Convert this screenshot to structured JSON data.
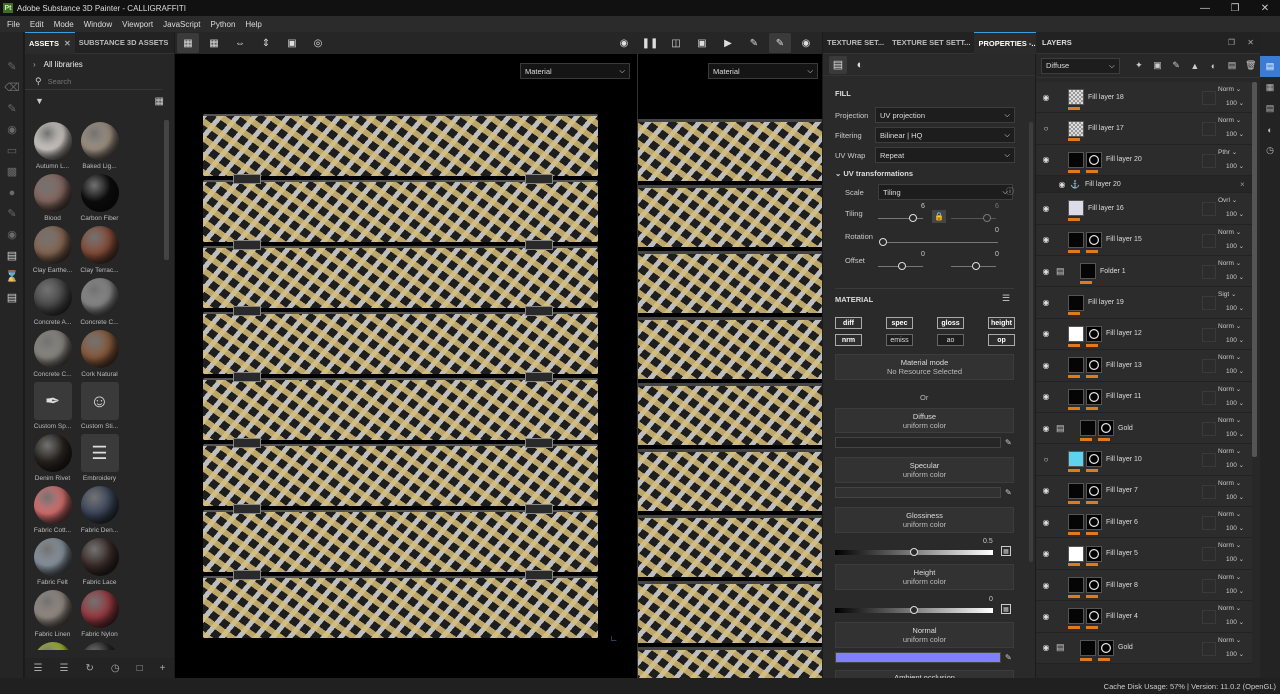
{
  "window": {
    "title": "Adobe Substance 3D Painter - CALLIGRAFFITI",
    "logo": "Pt"
  },
  "menu": [
    "File",
    "Edit",
    "Mode",
    "Window",
    "Viewport",
    "JavaScript",
    "Python",
    "Help"
  ],
  "assets": {
    "tabs": [
      "ASSETS",
      "SUBSTANCE 3D ASSETS"
    ],
    "library": "All libraries",
    "search_placeholder": "Search",
    "items": [
      {
        "name": "Autumn L...",
        "color": "#d9d4cf"
      },
      {
        "name": "Baked Lig...",
        "color": "#a69787"
      },
      {
        "name": "Blood",
        "color": "#8a6b63"
      },
      {
        "name": "Carbon Fiber",
        "color": "#0d0d0d"
      },
      {
        "name": "Clay Earthe...",
        "color": "#8b6a55"
      },
      {
        "name": "Clay Terrac...",
        "color": "#8a4f3a"
      },
      {
        "name": "Concrete A...",
        "color": "#4d4d4d"
      },
      {
        "name": "Concrete C...",
        "color": "#8d8d8d"
      },
      {
        "name": "Concrete C...",
        "color": "#8f8c84"
      },
      {
        "name": "Cork Natural",
        "color": "#8c5d3d"
      },
      {
        "name": "Custom Sp...",
        "color": "#3a3a3a",
        "icon": "spray-icon"
      },
      {
        "name": "Custom Sti...",
        "color": "#3a3a3a",
        "icon": "sticker-icon"
      },
      {
        "name": "Denim Rivet",
        "color": "#2a2520"
      },
      {
        "name": "Embroidery",
        "color": "#3a3a3a",
        "icon": "embroidery-icon"
      },
      {
        "name": "Fabric Cott...",
        "color": "#e07474"
      },
      {
        "name": "Fabric Den...",
        "color": "#3f4a5e"
      },
      {
        "name": "Fabric Felt",
        "color": "#8d9aa6"
      },
      {
        "name": "Fabric Lace",
        "color": "#3d2e2b"
      },
      {
        "name": "Fabric Linen",
        "color": "#9a9088"
      },
      {
        "name": "Fabric Nylon",
        "color": "#9b3b42"
      },
      {
        "name": "",
        "color": "#a8c02f"
      },
      {
        "name": "",
        "color": "#262626"
      }
    ]
  },
  "viewport": {
    "left_material": "Material",
    "right_material": "Material"
  },
  "properties": {
    "tabs": [
      "TEXTURE SET...",
      "TEXTURE SET SETT...",
      "PROPERTIES -..."
    ],
    "fill_title": "FILL",
    "projection_label": "Projection",
    "projection_value": "UV projection",
    "filtering_label": "Filtering",
    "filtering_value": "Bilinear | HQ",
    "uvwrap_label": "UV Wrap",
    "uvwrap_value": "Repeat",
    "uvtrans_title": "UV transformations",
    "scale_label": "Scale",
    "scale_value": "Tiling",
    "tiling_label": "Tiling",
    "tiling_value_a": "6",
    "tiling_value_b": "6",
    "rotation_label": "Rotation",
    "rotation_value": "0",
    "offset_label": "Offset",
    "offset_value_a": "0",
    "offset_value_b": "0",
    "material_title": "MATERIAL",
    "channels": [
      "diff",
      "spec",
      "gloss",
      "height",
      "nrm",
      "emiss",
      "ao",
      "op"
    ],
    "material_mode_label": "Material mode",
    "material_mode_value": "No Resource Selected",
    "or_label": "Or",
    "diffuse_label": "Diffuse",
    "diffuse_sub": "uniform color",
    "specular_label": "Specular",
    "specular_sub": "uniform color",
    "glossiness_label": "Glossiness",
    "glossiness_sub": "uniform color",
    "glossiness_value": "0.5",
    "height_label": "Height",
    "height_sub": "uniform color",
    "height_value": "0",
    "normal_label": "Normal",
    "normal_sub": "uniform color",
    "ambient_label": "Ambient occlusion",
    "normal_color": "#8080ff"
  },
  "layers": {
    "title": "LAYERS",
    "channel": "Diffuse",
    "items": [
      {
        "name": "Fill layer 18",
        "blend": "Norm",
        "opacity": "100",
        "thumb": "checker",
        "visible": true
      },
      {
        "name": "Fill layer 17",
        "blend": "Norm",
        "opacity": "100",
        "thumb": "checker",
        "visible": false
      },
      {
        "name": "Fill layer 20",
        "blend": "Pthr",
        "opacity": "100",
        "thumb": "dark",
        "mask": true,
        "visible": true
      },
      {
        "name": "Fill layer 20",
        "sub": true,
        "visible": true
      },
      {
        "name": "Fill layer 16",
        "blend": "Ovrl",
        "opacity": "100",
        "thumb": "#dcdce8",
        "visible": true
      },
      {
        "name": "Fill layer 15",
        "blend": "Norm",
        "opacity": "100",
        "thumb": "dark",
        "mask": true,
        "visible": true
      },
      {
        "name": "Folder 1",
        "blend": "Norm",
        "opacity": "100",
        "thumb": "folder",
        "visible": true
      },
      {
        "name": "Fill layer 19",
        "blend": "Sigt",
        "opacity": "100",
        "thumb": "dark",
        "visible": true
      },
      {
        "name": "Fill layer 12",
        "blend": "Norm",
        "opacity": "100",
        "thumb": "#ffffff",
        "mask": true,
        "visible": true
      },
      {
        "name": "Fill layer 13",
        "blend": "Norm",
        "opacity": "100",
        "thumb": "dark",
        "mask": true,
        "visible": true
      },
      {
        "name": "Fill layer 11",
        "blend": "Norm",
        "opacity": "100",
        "thumb": "dark",
        "mask": true,
        "visible": true
      },
      {
        "name": "Gold",
        "blend": "Norm",
        "opacity": "100",
        "thumb": "folder",
        "mask": true,
        "visible": true
      },
      {
        "name": "Fill layer 10",
        "blend": "Norm",
        "opacity": "100",
        "thumb": "#5ed3ee",
        "mask": true,
        "visible": false
      },
      {
        "name": "Fill layer 7",
        "blend": "Norm",
        "opacity": "100",
        "thumb": "dark",
        "mask": true,
        "visible": true
      },
      {
        "name": "Fill layer 6",
        "blend": "Norm",
        "opacity": "100",
        "thumb": "dark",
        "mask": true,
        "visible": true
      },
      {
        "name": "Fill layer 5",
        "blend": "Norm",
        "opacity": "100",
        "thumb": "#ffffff",
        "mask": true,
        "visible": true
      },
      {
        "name": "Fill layer 8",
        "blend": "Norm",
        "opacity": "100",
        "thumb": "dark",
        "mask": true,
        "visible": true
      },
      {
        "name": "Fill layer 4",
        "blend": "Norm",
        "opacity": "100",
        "thumb": "dark",
        "mask": true,
        "visible": true
      },
      {
        "name": "Gold",
        "blend": "Norm",
        "opacity": "100",
        "thumb": "folder",
        "mask": true,
        "visible": true
      }
    ]
  },
  "status": {
    "text": "Cache Disk Usage:   57% | Version: 11.0.2 (OpenGL)"
  }
}
